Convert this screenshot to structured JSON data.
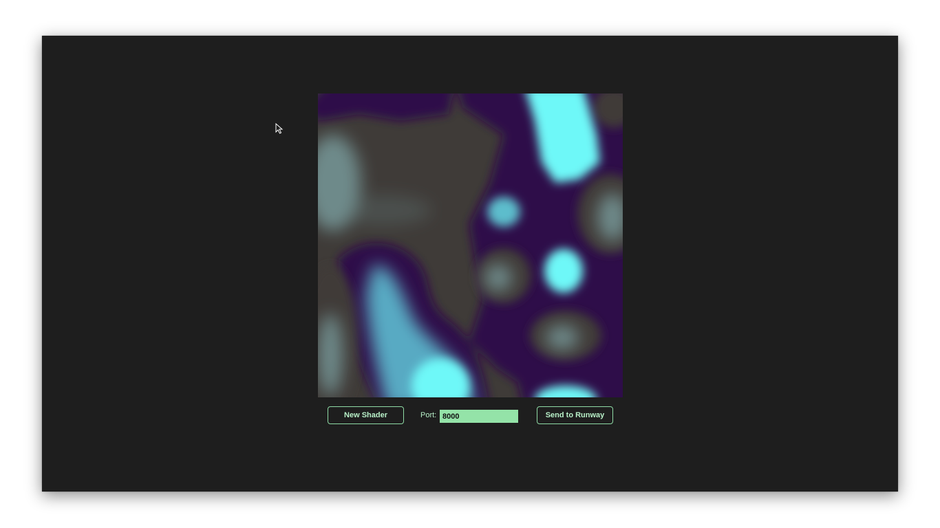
{
  "controls": {
    "new_shader_label": "New Shader",
    "port_label": "Port:",
    "port_value": "8000",
    "send_label": "Send to Runway"
  },
  "colors": {
    "background": "#1e1e1e",
    "accent": "#8fdca6",
    "input_fill": "#94e3a8",
    "shader_cyan": "#6ef8f8",
    "shader_purple": "#2d0748",
    "shader_brown": "#3f3b38",
    "shader_grey": "#6e8a8a"
  },
  "icons": {
    "cursor": "mouse-pointer-icon"
  }
}
